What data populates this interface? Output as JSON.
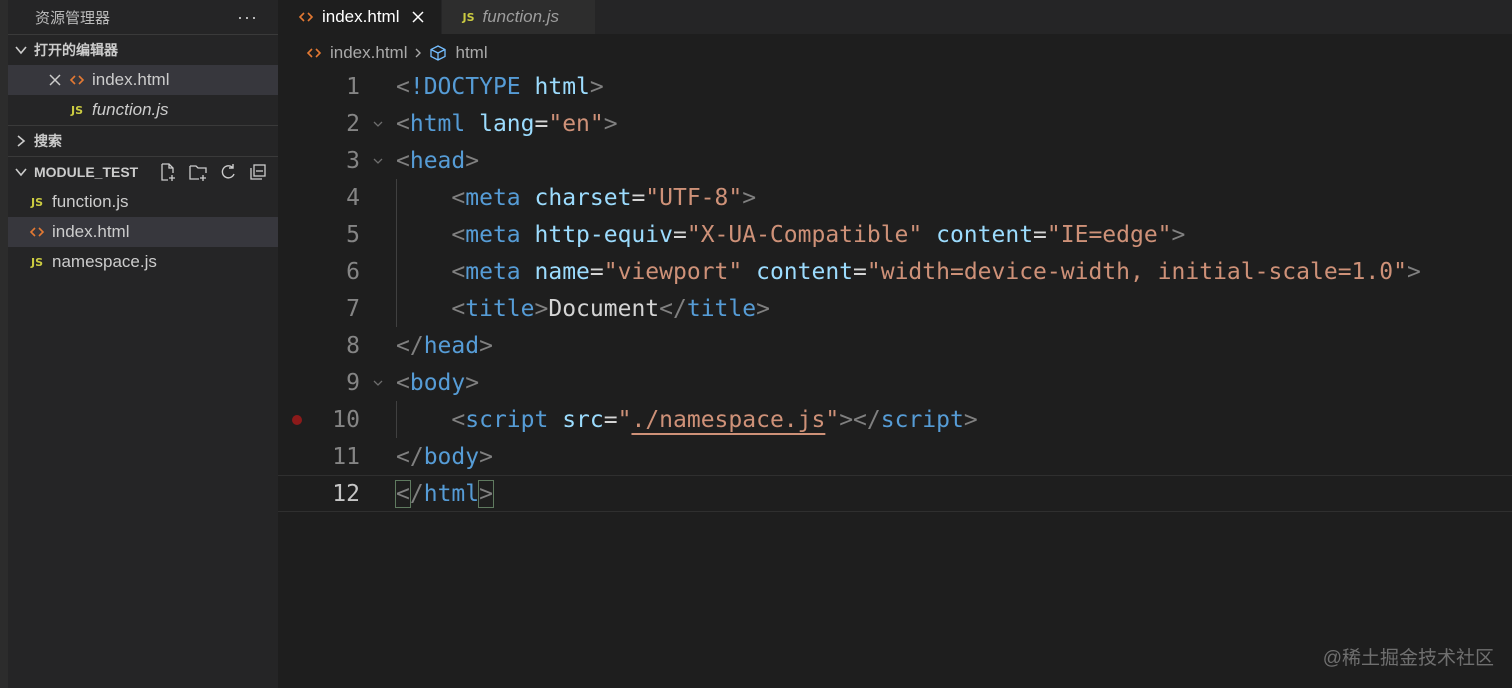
{
  "sidebar": {
    "title": "资源管理器",
    "more": "···",
    "open_editors": {
      "label": "打开的编辑器",
      "items": [
        {
          "name": "index.html",
          "type": "html"
        },
        {
          "name": "function.js",
          "type": "js"
        }
      ]
    },
    "search": {
      "label": "搜索"
    },
    "project": {
      "label": "MODULE_TEST",
      "files": [
        {
          "name": "function.js",
          "type": "js"
        },
        {
          "name": "index.html",
          "type": "html"
        },
        {
          "name": "namespace.js",
          "type": "js"
        }
      ]
    }
  },
  "tabs": [
    {
      "label": "index.html",
      "type": "html",
      "active": true
    },
    {
      "label": "function.js",
      "type": "js",
      "active": false
    }
  ],
  "breadcrumb": [
    "index.html",
    "html"
  ],
  "code": {
    "lines": [
      "1",
      "2",
      "3",
      "4",
      "5",
      "6",
      "7",
      "8",
      "9",
      "10",
      "11",
      "12"
    ],
    "tokens": {
      "doctype": "<!DOCTYPE",
      "html": "html",
      "lang": "lang",
      "en": "\"en\"",
      "head": "head",
      "meta": "meta",
      "charset": "charset",
      "utf8": "\"UTF-8\"",
      "http_equiv": "http-equiv",
      "xua": "\"X-UA-Compatible\"",
      "content": "content",
      "ieedge": "\"IE=edge\"",
      "name": "name",
      "viewport": "\"viewport\"",
      "viewport_val": "\"width=device-width, initial-scale=1.0\"",
      "title": "title",
      "document": "Document",
      "body": "body",
      "script": "script",
      "src": "src",
      "src_val": "./namespace.js"
    }
  },
  "watermark": "@稀土掘金技术社区",
  "icons": {
    "js_badge": "JS",
    "html_badge": "<>"
  }
}
